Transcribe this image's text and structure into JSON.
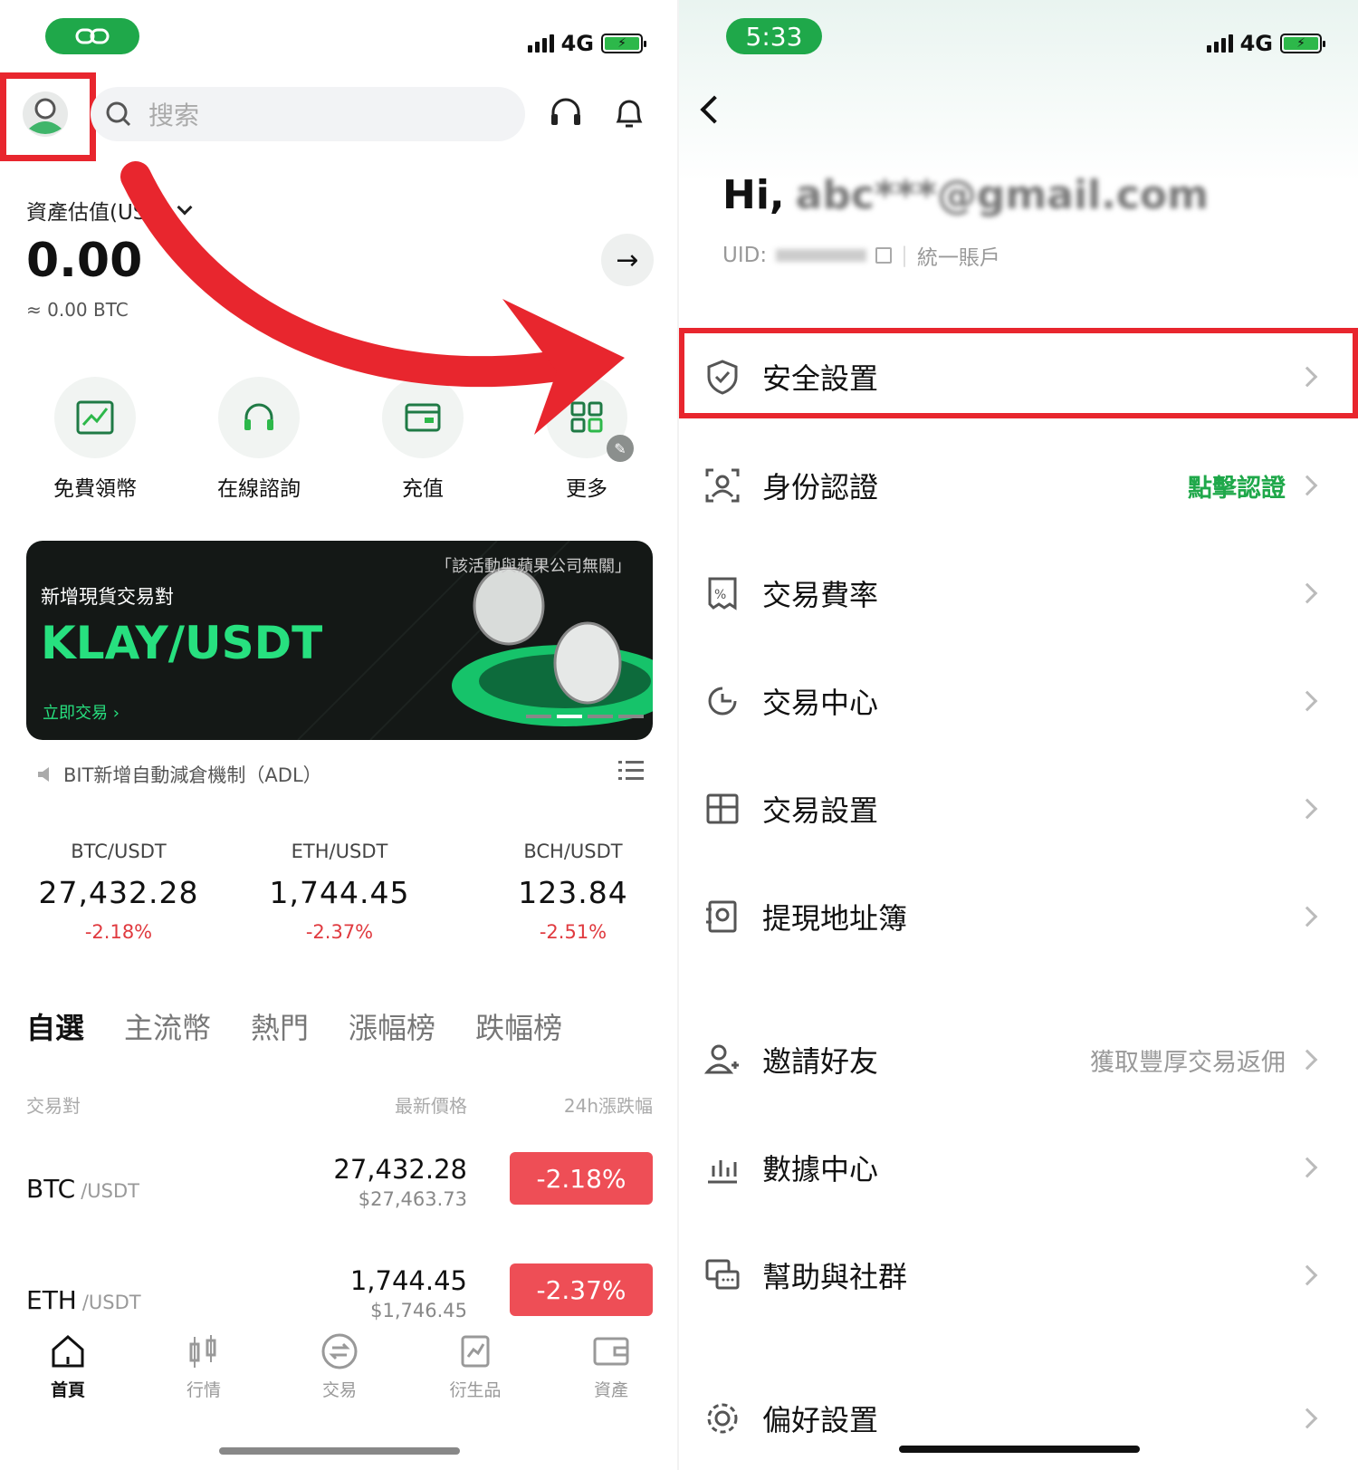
{
  "left": {
    "status": {
      "network": "4G"
    },
    "search": {
      "placeholder": "搜索"
    },
    "asset": {
      "label": "資產估值(USD)",
      "value": "0.00",
      "btc": "≈ 0.00 BTC"
    },
    "quick_actions": [
      {
        "label": "免費領幣",
        "icon": "chart-up-icon"
      },
      {
        "label": "在線諮詢",
        "icon": "headset-icon"
      },
      {
        "label": "充值",
        "icon": "wallet-icon"
      },
      {
        "label": "更多",
        "icon": "grid-icon"
      }
    ],
    "banner": {
      "disclaimer": "「該活動與蘋果公司無關」",
      "subtitle": "新增現貨交易對",
      "title": "KLAY/USDT",
      "cta": "立即交易"
    },
    "notice": "BIT新增自動減倉機制（ADL）",
    "tickers": [
      {
        "pair": "BTC/USDT",
        "price": "27,432.28",
        "change": "-2.18%"
      },
      {
        "pair": "ETH/USDT",
        "price": "1,744.45",
        "change": "-2.37%"
      },
      {
        "pair": "BCH/USDT",
        "price": "123.84",
        "change": "-2.51%"
      }
    ],
    "market_tabs": [
      "自選",
      "主流幣",
      "熱門",
      "漲幅榜",
      "跌幅榜"
    ],
    "list_headers": {
      "pair": "交易對",
      "price": "最新價格",
      "change": "24h漲跌幅"
    },
    "rows": [
      {
        "base": "BTC",
        "quote": "/USDT",
        "price": "27,432.28",
        "usd": "$27,463.73",
        "change": "-2.18%"
      },
      {
        "base": "ETH",
        "quote": "/USDT",
        "price": "1,744.45",
        "usd": "$1,746.45",
        "change": "-2.37%"
      }
    ],
    "bottom_nav": [
      {
        "label": "首頁",
        "icon": "home-icon"
      },
      {
        "label": "行情",
        "icon": "candlestick-icon"
      },
      {
        "label": "交易",
        "icon": "exchange-icon"
      },
      {
        "label": "衍生品",
        "icon": "derivatives-icon"
      },
      {
        "label": "資產",
        "icon": "asset-wallet-icon"
      }
    ]
  },
  "right": {
    "status": {
      "time": "5:33",
      "network": "4G"
    },
    "greeting": "Hi,",
    "email_masked": "abc***@gmail.com",
    "uid_label": "UID:",
    "account_type": "統一賬戶",
    "menu": [
      {
        "label": "安全設置",
        "right": "",
        "icon": "shield-icon"
      },
      {
        "label": "身份認證",
        "right": "點擊認證",
        "icon": "id-scan-icon"
      },
      {
        "label": "交易費率",
        "right": "",
        "icon": "fee-rate-icon"
      },
      {
        "label": "交易中心",
        "right": "",
        "icon": "trade-center-icon"
      },
      {
        "label": "交易設置",
        "right": "",
        "icon": "trade-settings-icon"
      },
      {
        "label": "提現地址簿",
        "right": "",
        "icon": "address-book-icon"
      },
      {
        "label": "邀請好友",
        "right": "獲取豐厚交易返佣",
        "icon": "invite-user-icon"
      },
      {
        "label": "數據中心",
        "right": "",
        "icon": "data-center-icon"
      },
      {
        "label": "幫助與社群",
        "right": "",
        "icon": "help-community-icon"
      },
      {
        "label": "偏好設置",
        "right": "",
        "icon": "gear-icon"
      }
    ]
  },
  "colors": {
    "accent": "#1fa84a",
    "down": "#ee4e56",
    "highlight": "#e8262e"
  }
}
